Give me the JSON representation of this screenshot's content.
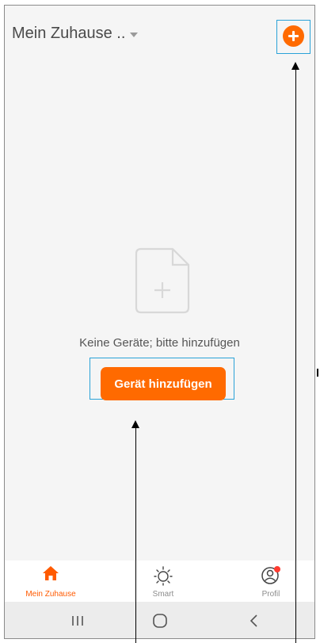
{
  "header": {
    "home_title": "Mein Zuhause ..",
    "add_icon": "plus-circle-icon"
  },
  "empty_state": {
    "icon": "add-file-icon",
    "message": "Keine Geräte; bitte hinzufügen",
    "button_label": "Gerät hinzufügen"
  },
  "tabs": [
    {
      "label": "Mein Zuhause",
      "icon": "home-icon",
      "active": true
    },
    {
      "label": "Smart",
      "icon": "sun-icon",
      "active": false
    },
    {
      "label": "Profil",
      "icon": "user-icon",
      "active": false,
      "notification_dot": true
    }
  ],
  "navbar": {
    "recents_icon": "recents-icon",
    "home_icon": "home-circle-icon",
    "back_icon": "back-chevron-icon"
  },
  "colors": {
    "accent": "#ff6a00",
    "tab_active": "#ff5a00",
    "highlight": "#2aa2d8",
    "background": "#f5f5f5",
    "notification": "#ff3b30"
  }
}
